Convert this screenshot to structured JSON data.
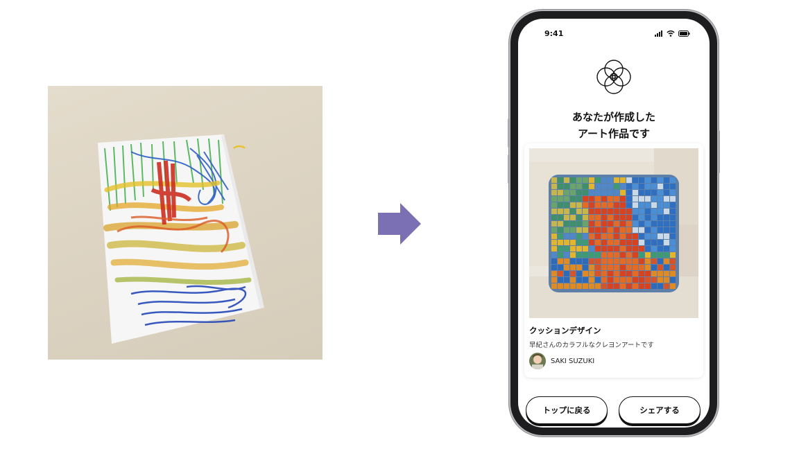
{
  "status_bar": {
    "time": "9:41"
  },
  "headline": {
    "line1": "あなたが作成した",
    "line2": "アート作品です"
  },
  "card": {
    "title": "クッションデザイン",
    "description": "早紀さんのカラフルなクレヨンアートです",
    "author": "SAKI SUZUKI"
  },
  "buttons": {
    "back": "トップに戻る",
    "share": "シェアする"
  },
  "colors": {
    "arrow": "#7b70b4",
    "phone_frame": "#1d1d1f",
    "text": "#111111"
  },
  "icons": [
    "signal-icon",
    "wifi-icon",
    "battery-icon",
    "overlapping-circles-logo-icon",
    "right-arrow-icon"
  ]
}
